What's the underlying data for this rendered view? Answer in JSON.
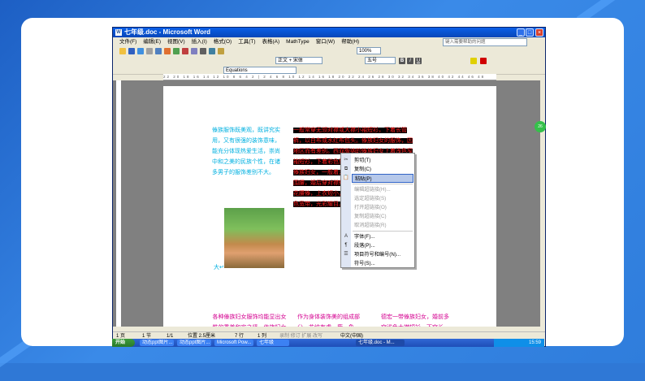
{
  "window": {
    "title": "七年级.doc - Microsoft Word"
  },
  "menu": {
    "items": [
      "文件(F)",
      "编辑(E)",
      "视图(V)",
      "插入(I)",
      "格式(O)",
      "工具(T)",
      "表格(A)",
      "MathType",
      "窗口(W)",
      "帮助(H)"
    ],
    "help_placeholder": "键入需要帮助的问题"
  },
  "format_toolbar": {
    "style": "正文 + 宋体",
    "size": "五号",
    "zoom": "100%"
  },
  "equation_toolbar": {
    "combo": "Equations"
  },
  "ruler_text": "22 20 18 16 14 12 10 8 6 4 2 | 2 4 6 8 10 12 14 16 18 20 22 24 26 28 30 32 34 36 38 40 42 44 46 48",
  "document": {
    "col1_text": "傣族服饰既美观，既讲究实用，又有很强的装饰意味，能充分体现热爱生活，崇尚中和之美的民族个性，在诸多男子的服饰差别不大。",
    "col2_text": "一般常穿无领对襟或大襟小袖短衫，下着长管裤，以白布或水红布包头。傣族妇女的服饰，因地区而有差别。西双版纳的傣族妇女上着浅色窄袖短衫，下着彩色筒裙，长及脚面。德宏一带的傣族妇女，一般着大襟短衫，下着长裤，束一小围腰，婚后穿对襟短衫和筒裙。新平元江一带的花腰傣，上衣短小，下着筒裙，并在腰部束以彩色宽带，光彩耀目。",
    "col3a_text": "各种傣族妇女服饰均能显出女性的秀美和实之贤，傣族妇女均爱留长发，用于头顶，有的以梳子或鲜花为饰。",
    "col3b_text": "作为身体装饰美的组成部分，花纹有虎、鹿、象",
    "col3c_text": "德宏一带傣族妇女，婚前多穿浅色大襟短衫，下穿长裤，束一小围腰，婚后穿对襟短衫，花色或黑色"
  },
  "context_menu": {
    "items": [
      {
        "label": "剪切(T)",
        "icon": "cut-icon",
        "disabled": false
      },
      {
        "label": "复制(C)",
        "icon": "copy-icon",
        "disabled": false
      },
      {
        "label": "粘贴(P)",
        "icon": "paste-icon",
        "disabled": false,
        "highlighted": true
      },
      {
        "label": "编辑超链接(H)...",
        "icon": "",
        "disabled": true
      },
      {
        "label": "选定超链接(S)",
        "icon": "",
        "disabled": true
      },
      {
        "label": "打开超链接(O)",
        "icon": "",
        "disabled": true
      },
      {
        "label": "复制超链接(C)",
        "icon": "",
        "disabled": true
      },
      {
        "label": "取消超链接(R)",
        "icon": "",
        "disabled": true
      },
      {
        "label": "字体(F)...",
        "icon": "font-icon",
        "disabled": false
      },
      {
        "label": "段落(P)...",
        "icon": "paragraph-icon",
        "disabled": false
      },
      {
        "label": "项目符号和编号(N)...",
        "icon": "bullets-icon",
        "disabled": false
      },
      {
        "label": "符号(S)...",
        "icon": "",
        "disabled": false
      }
    ]
  },
  "status": {
    "page": "1 页",
    "section": "1 节",
    "pages": "1/1",
    "position": "位置 2.5厘米",
    "line": "7 行",
    "col": "1 列",
    "modes": "录制  修订  扩展  改写",
    "lang": "中文(中国)"
  },
  "taskbar": {
    "start": "开始",
    "tasks": [
      "动态ppt图片...",
      "动态ppt图片...",
      "Microsoft Pow...",
      "七年级"
    ],
    "active_task": "七年级.doc - M...",
    "clock": "15:59"
  },
  "colors": {
    "cyan_text": "#00b0e0",
    "red_text": "#ff2020",
    "magenta_text": "#d40090"
  }
}
